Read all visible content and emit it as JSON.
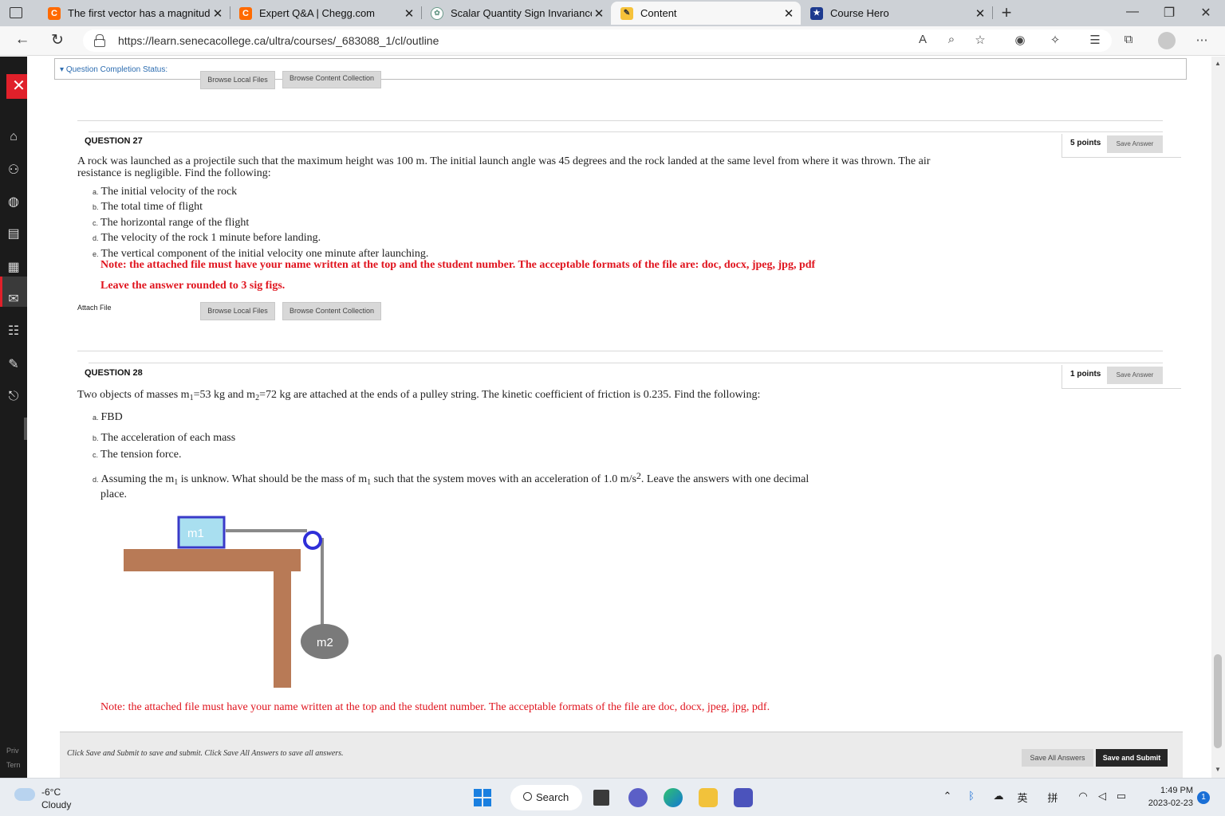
{
  "browser": {
    "tabs": [
      {
        "title": "The first vector has a magnitude",
        "favicon": "chegg-c-icon"
      },
      {
        "title": "Expert Q&A | Chegg.com",
        "favicon": "chegg-c-icon"
      },
      {
        "title": "Scalar Quantity Sign Invariance.",
        "favicon": "chatgpt-icon"
      },
      {
        "title": "Content",
        "favicon": "pencil-page-icon",
        "active": true
      },
      {
        "title": "Course Hero",
        "favicon": "course-hero-star-icon"
      }
    ],
    "url": "https://learn.senecacollege.ca/ultra/courses/_683088_1/cl/outline",
    "colors": {
      "chegg": "#ff6a00",
      "accent": "#e0141e",
      "taskbar_blue": "#1a7fe0"
    }
  },
  "content": {
    "completion_status": "Question Completion Status:",
    "browse_local": "Browse Local Files",
    "browse_collection": "Browse Content Collection",
    "q27": {
      "title": "QUESTION 27",
      "points": "5 points",
      "save": "Save Answer",
      "text": "A rock was launched as a projectile such that the maximum height was 100 m. The initial launch angle was 45 degrees and the rock landed at the same level from where it was thrown. The air resistance is negligible. Find the following:",
      "items": [
        {
          "mark": "a.",
          "text": "The initial velocity of the rock"
        },
        {
          "mark": "b.",
          "text": "The total time of flight"
        },
        {
          "mark": "c.",
          "text": "The horizontal range of the flight"
        },
        {
          "mark": "d.",
          "text": "The velocity of the rock 1 minute before landing."
        },
        {
          "mark": "e.",
          "text": "The vertical component of the initial velocity one minute after launching."
        }
      ],
      "note": "Note: the attached file must have your name written at the top and the student number. The acceptable formats of the file are: doc, docx, jpeg, jpg, pdf",
      "round": "Leave the answer rounded to 3 sig figs.",
      "attach": "Attach File"
    },
    "q28": {
      "title": "QUESTION 28",
      "points": "1 points",
      "save": "Save Answer",
      "text_parts": [
        "Two objects of masses m",
        "1",
        "=53 kg and m",
        "2",
        "=72 kg are attached at the ends of a pulley string. The kinetic coefficient of friction is 0.235. Find the following:"
      ],
      "items": [
        {
          "mark": "a.",
          "text": "FBD"
        },
        {
          "mark": "b.",
          "text": "The acceleration of each mass"
        },
        {
          "mark": "c.",
          "text": "The tension force."
        }
      ],
      "item_d": {
        "mark": "d.",
        "p1": "Assuming the m",
        "s1": "1",
        "p2": " is unknow. What should be the mass of m",
        "s2": "1",
        "p3": " such that the system moves with an acceleration of 1.0 m/s",
        "sup": "2",
        "p4": ". Leave the answers with one decimal",
        "p5": "place."
      },
      "diagram": {
        "m1": "m1",
        "m2": "m2"
      },
      "note": "Note: the attached file must have your name written at the top and the student number. The acceptable formats of the file are doc, docx, jpeg, jpg, pdf."
    },
    "footer": {
      "hint": "Click Save and Submit to save and submit. Click Save All Answers to save all answers.",
      "save_all": "Save All Answers",
      "submit": "Save and Submit"
    },
    "rail_footer": [
      "Priv",
      "Tern"
    ]
  },
  "taskbar": {
    "temp": "-6°C",
    "weather": "Cloudy",
    "search": "Search",
    "lang1": "英",
    "lang2": "拼",
    "time": "1:49 PM",
    "date": "2023-02-23",
    "notifications": "1"
  }
}
